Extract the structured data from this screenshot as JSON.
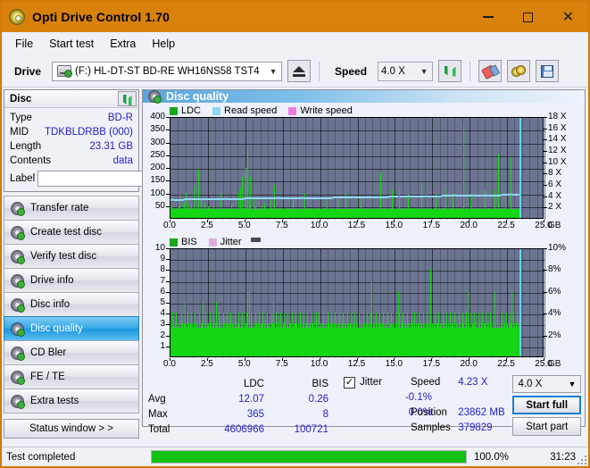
{
  "window": {
    "title": "Opti Drive Control 1.70",
    "icon": "disc-icon",
    "minimize": "—",
    "maximize": "□",
    "close": "✕"
  },
  "menu": [
    "File",
    "Start test",
    "Extra",
    "Help"
  ],
  "toolbar": {
    "drive_label": "Drive",
    "drive_value": "(F:)  HL-DT-ST BD-RE  WH16NS58 TST4",
    "eject_icon": "eject-icon",
    "speed_label": "Speed",
    "speed_value": "4.0 X",
    "refresh_icon": "refresh-icon",
    "erase_icon": "erase-icon",
    "discs_icon": "discs-icon",
    "save_icon": "save-icon"
  },
  "disc_panel": {
    "title": "Disc",
    "refresh_icon": "refresh-icon",
    "rows": [
      {
        "key": "Type",
        "value": "BD-R"
      },
      {
        "key": "MID",
        "value": "TDKBLDRBB (000)"
      },
      {
        "key": "Length",
        "value": "23.31 GB"
      },
      {
        "key": "Contents",
        "value": "data"
      }
    ],
    "label_key": "Label",
    "label_value": "",
    "label_button_icon": "cd-icon"
  },
  "nav": {
    "items": [
      {
        "label": "Transfer rate",
        "icon": "disc-transfer-icon",
        "active": false
      },
      {
        "label": "Create test disc",
        "icon": "disc-create-icon",
        "active": false
      },
      {
        "label": "Verify test disc",
        "icon": "disc-verify-icon",
        "active": false
      },
      {
        "label": "Drive info",
        "icon": "disc-drive-icon",
        "active": false
      },
      {
        "label": "Disc info",
        "icon": "disc-info-icon",
        "active": false
      },
      {
        "label": "Disc quality",
        "icon": "disc-quality-icon",
        "active": true
      },
      {
        "label": "CD Bler",
        "icon": "disc-bler-icon",
        "active": false
      },
      {
        "label": "FE / TE",
        "icon": "disc-fete-icon",
        "active": false
      },
      {
        "label": "Extra tests",
        "icon": "disc-extra-icon",
        "active": false
      }
    ],
    "status_window": "Status window > >"
  },
  "content": {
    "title": "Disc quality",
    "title_icon": "disc-quality-icon"
  },
  "chart_data": [
    {
      "type": "bar",
      "name": "ldc-chart",
      "title": "",
      "legend": [
        {
          "label": "LDC",
          "color": "#1aa81a"
        },
        {
          "label": "Read speed",
          "color": "#8fd8f5"
        },
        {
          "label": "Write speed",
          "color": "#f07ae0"
        }
      ],
      "xlabel": "GB",
      "xlim": [
        0,
        25.0
      ],
      "xticks": [
        "0.0",
        "2.5",
        "5.0",
        "7.5",
        "10.0",
        "12.5",
        "15.0",
        "17.5",
        "20.0",
        "22.5",
        "25.0"
      ],
      "ylabel_left": "LDC",
      "ylim": [
        0,
        400
      ],
      "yticks": [
        50,
        100,
        150,
        200,
        250,
        300,
        350,
        400
      ],
      "ylabel_right": "Speed",
      "ylim_right": [
        0,
        18
      ],
      "yticks_right": [
        "2 X",
        "4 X",
        "6 X",
        "8 X",
        "10 X",
        "12 X",
        "14 X",
        "16 X",
        "18 X"
      ],
      "grid": true,
      "data_end_gb": 23.31,
      "baseline": 35,
      "values": [
        48,
        42,
        38,
        36,
        34,
        33,
        40,
        36,
        33,
        34,
        36,
        44,
        33,
        92,
        36,
        34,
        35,
        38,
        33,
        60,
        34,
        33,
        100,
        35,
        34,
        33,
        48,
        36,
        33,
        34,
        55,
        33,
        37,
        120,
        34,
        33,
        36,
        42,
        33,
        35,
        190,
        33,
        36,
        34,
        70,
        33,
        35,
        33,
        38,
        60,
        33,
        34,
        36,
        33,
        45,
        33,
        34,
        38,
        33,
        36,
        34,
        33,
        55,
        33,
        34,
        36,
        33,
        38,
        33,
        34,
        33,
        36,
        100,
        33,
        34,
        33,
        38,
        34,
        33,
        36,
        33,
        34,
        40,
        33,
        36,
        33,
        34,
        52,
        33,
        36,
        34,
        33,
        38,
        33,
        35,
        33,
        34,
        100,
        33,
        36,
        120,
        33,
        35,
        160,
        33,
        38,
        33,
        195,
        34,
        36,
        280,
        34,
        33,
        45,
        160,
        33,
        36,
        34,
        33,
        80,
        34,
        33,
        45,
        33,
        36,
        34,
        33,
        38,
        33,
        34,
        44,
        33,
        36,
        33,
        34,
        60,
        33,
        38,
        34,
        33,
        36,
        33,
        34,
        75,
        33,
        36,
        34,
        33,
        130,
        34,
        33,
        36,
        33,
        38,
        33,
        34,
        36,
        33,
        34,
        33,
        38,
        33,
        36,
        34,
        33,
        40,
        33,
        36,
        33,
        34,
        38,
        33,
        36,
        34,
        33,
        70,
        33,
        36,
        33,
        34,
        38,
        33,
        36,
        33,
        34,
        36,
        33,
        38,
        34,
        33,
        36,
        33,
        100,
        34,
        33,
        36,
        33,
        38,
        33,
        34,
        36,
        33,
        38,
        33,
        36,
        34,
        33,
        36,
        33,
        38,
        33,
        34,
        36,
        33,
        38,
        33,
        36,
        34,
        33,
        38,
        33,
        36,
        33,
        34,
        80,
        33,
        36,
        33,
        34,
        38,
        33,
        36,
        34,
        33,
        38,
        33,
        36,
        33,
        34,
        72,
        33,
        36,
        34,
        33,
        38,
        33,
        36,
        33,
        34,
        36,
        33,
        105,
        34,
        33,
        38,
        33,
        36,
        33,
        34,
        38,
        33,
        36,
        34,
        33,
        38,
        33,
        36,
        33,
        34,
        38,
        33,
        36,
        33,
        80,
        38,
        33,
        36,
        34,
        33,
        38,
        33,
        36,
        33,
        34,
        38,
        33,
        36,
        34,
        33,
        36,
        33,
        38,
        33,
        34,
        36,
        33,
        38,
        33,
        36,
        34,
        33,
        180,
        33,
        36,
        34,
        33,
        38,
        33,
        36,
        33,
        34,
        36,
        33,
        38,
        34,
        33,
        36,
        33,
        110,
        33,
        36,
        34,
        33,
        38,
        33,
        36,
        33,
        34,
        120,
        33,
        36,
        34,
        33,
        38,
        33,
        36,
        33,
        34,
        38,
        33,
        90,
        34,
        33,
        36,
        33,
        38,
        33,
        34,
        36,
        33,
        38,
        33,
        36,
        34,
        33,
        38,
        33,
        36,
        33,
        34,
        140,
        33,
        36,
        34,
        33,
        38,
        33,
        36,
        33,
        34,
        36,
        33,
        38,
        34,
        33,
        36,
        33,
        38,
        33,
        34,
        95,
        33,
        36,
        33,
        34,
        38,
        33,
        36,
        34,
        33,
        38,
        33,
        36,
        33,
        120,
        38,
        33,
        36,
        33,
        34,
        38,
        33,
        36,
        34,
        33,
        95,
        33,
        36,
        33,
        34,
        38,
        33,
        36,
        34,
        33,
        38,
        33,
        36,
        33,
        34,
        365,
        33,
        36,
        34,
        33,
        38,
        33,
        36,
        33,
        34,
        90,
        33,
        36,
        34,
        33,
        38,
        33,
        36,
        33,
        34,
        38,
        33,
        36,
        33,
        34,
        38,
        33,
        36,
        34,
        33,
        110,
        33,
        36,
        33,
        34,
        38,
        33,
        36,
        34,
        33,
        38,
        33,
        36,
        33,
        34,
        110,
        33,
        36,
        33,
        34,
        250,
        33,
        36,
        34,
        33,
        38,
        33,
        36,
        33,
        34,
        85,
        33,
        36,
        34,
        33,
        38,
        33,
        240,
        33,
        34,
        36,
        33,
        38,
        34,
        33,
        36,
        33,
        38,
        33,
        34
      ],
      "read_speed": [
        3.6,
        3.7,
        3.7,
        3.7,
        3.8,
        3.8,
        3.8,
        3.8,
        3.8,
        3.8,
        3.8,
        3.8,
        3.8,
        3.8,
        3.8,
        3.8,
        3.85,
        3.85,
        3.85,
        3.85,
        3.85,
        3.9,
        3.9,
        3.9,
        3.9,
        3.9,
        3.9,
        3.9,
        3.9,
        3.9,
        3.9,
        3.95,
        3.95,
        3.95,
        3.95,
        3.95,
        3.95,
        3.95,
        4.0,
        4.0,
        4.0,
        4.0,
        4.0,
        4.0,
        4.0,
        4.0,
        4.05,
        4.05,
        4.05,
        4.05,
        4.05,
        4.05,
        4.1,
        4.1,
        4.1,
        4.1,
        4.1,
        4.15,
        4.15,
        4.15,
        4.15,
        4.15,
        4.2,
        4.2,
        4.2,
        4.2,
        4.2,
        4.2,
        4.25,
        4.25,
        4.25,
        4.25,
        4.25,
        4.3,
        4.3,
        4.3,
        4.3,
        4.35,
        4.35,
        4.35,
        4.35,
        4.4,
        4.4,
        4.4,
        4.4,
        4.4,
        4.45,
        4.45,
        4.45,
        4.5,
        4.5,
        4.5,
        4.5,
        4.5,
        4.55,
        4.55,
        4.55,
        4.6,
        4.6,
        4.6
      ]
    },
    {
      "type": "bar",
      "name": "bis-chart",
      "title": "",
      "legend": [
        {
          "label": "BIS",
          "color": "#1aa81a"
        },
        {
          "label": "Jitter",
          "color": "#e0aee0"
        }
      ],
      "xlabel": "GB",
      "xlim": [
        0,
        25.0
      ],
      "xticks": [
        "0.0",
        "2.5",
        "5.0",
        "7.5",
        "10.0",
        "12.5",
        "15.0",
        "17.5",
        "20.0",
        "22.5",
        "25.0"
      ],
      "ylabel_left": "BIS",
      "ylim": [
        0,
        10
      ],
      "yticks": [
        1,
        2,
        3,
        4,
        5,
        6,
        7,
        8,
        9,
        10
      ],
      "ylabel_right": "Jitter",
      "ylim_right": [
        0,
        10
      ],
      "yticks_right": [
        "2%",
        "4%",
        "6%",
        "8%",
        "10%"
      ],
      "grid": true,
      "data_end_gb": 23.31,
      "baseline": 2.6,
      "values": [
        3,
        2,
        4,
        2,
        3,
        2,
        3,
        2,
        4,
        2,
        3,
        2,
        2,
        3,
        2,
        4,
        2,
        3,
        2,
        3,
        5,
        2,
        3,
        2,
        4,
        2,
        3,
        2,
        3,
        4,
        2,
        3,
        2,
        3,
        2,
        4,
        2,
        3,
        2,
        3,
        2,
        4,
        2,
        3,
        2,
        3,
        5,
        2,
        3,
        2,
        4,
        2,
        3,
        2,
        3,
        2,
        4,
        2,
        3,
        2,
        3,
        2,
        4,
        2,
        3,
        5,
        2,
        3,
        2,
        4,
        2,
        3,
        2,
        3,
        2,
        4,
        2,
        3,
        2,
        3,
        4,
        2,
        3,
        2,
        3,
        2,
        4,
        2,
        3,
        2,
        3,
        2,
        4,
        2,
        3,
        2,
        3,
        4,
        2,
        3,
        2,
        3,
        2,
        4,
        2,
        3,
        2,
        3,
        2,
        4,
        6,
        2,
        3,
        6,
        2,
        4,
        2,
        3,
        2,
        3,
        2,
        4,
        2,
        3,
        2,
        3,
        2,
        4,
        2,
        3,
        2,
        3,
        4,
        2,
        3,
        2,
        3,
        2,
        4,
        2,
        3,
        2,
        3,
        2,
        4,
        2,
        3,
        5,
        2,
        3,
        2,
        4,
        2,
        3,
        2,
        3,
        2,
        4,
        2,
        3,
        2,
        3,
        4,
        2,
        3,
        2,
        3,
        2,
        4,
        2,
        3,
        2,
        3,
        2,
        4,
        2,
        3,
        2,
        3,
        4,
        2,
        3,
        2,
        3,
        2,
        4,
        2,
        3,
        2,
        3,
        2,
        4,
        2,
        3,
        2,
        3,
        4,
        2,
        3,
        2,
        3,
        2,
        4,
        2,
        3,
        2,
        3,
        2,
        4,
        2,
        3,
        2,
        3,
        4,
        2,
        3,
        2,
        3,
        2,
        4,
        2,
        3,
        2,
        3,
        2,
        4,
        2,
        3,
        2,
        3,
        4,
        2,
        3,
        2,
        3,
        2,
        4,
        2,
        3,
        2,
        3,
        2,
        4,
        2,
        3,
        2,
        3,
        4,
        2,
        3,
        2,
        3,
        2,
        4,
        2,
        3,
        2,
        3,
        2,
        4,
        2,
        3,
        2,
        3,
        4,
        2,
        3,
        2,
        3,
        2,
        4,
        2,
        3,
        2,
        3,
        2,
        4,
        2,
        3,
        2,
        3,
        4,
        2,
        3,
        2,
        3,
        2,
        4,
        7,
        2,
        3,
        2,
        3,
        2,
        4,
        2,
        3,
        2,
        3,
        4,
        2,
        3,
        2,
        3,
        2,
        4,
        2,
        3,
        2,
        3,
        2,
        4,
        2,
        3,
        2,
        3,
        4,
        2,
        3,
        2,
        3,
        2,
        4,
        2,
        3,
        2,
        6,
        2,
        4,
        2,
        3,
        2,
        3,
        4,
        2,
        3,
        2,
        3,
        2,
        4,
        2,
        3,
        2,
        3,
        2,
        4,
        2,
        3,
        2,
        3,
        4,
        2,
        3,
        2,
        3,
        2,
        4,
        2,
        3,
        2,
        3,
        2,
        4,
        2,
        3,
        2,
        3,
        4,
        2,
        3,
        2,
        3,
        2,
        8,
        2,
        3,
        2,
        3,
        2,
        4,
        2,
        3,
        2,
        3,
        4,
        2,
        3,
        2,
        3,
        2,
        4,
        2,
        3,
        2,
        3,
        2,
        4,
        2,
        3,
        2,
        3,
        4,
        2,
        3,
        2,
        3,
        2,
        4,
        2,
        3,
        2,
        3,
        2,
        4,
        2,
        3,
        2,
        3,
        4,
        2,
        3,
        2,
        3,
        2,
        4,
        2,
        3,
        2,
        6,
        2,
        4,
        2,
        3,
        2,
        3,
        4,
        2,
        3,
        2,
        3,
        2,
        4,
        2,
        3,
        2,
        3,
        2,
        4,
        2,
        3,
        2,
        3,
        4,
        2,
        3,
        2,
        3,
        2,
        4,
        2,
        3,
        2,
        3,
        2,
        6,
        2,
        3,
        2,
        3,
        4,
        2,
        3,
        2,
        3,
        2,
        4,
        2,
        3,
        2,
        3,
        2,
        4,
        2,
        3,
        2,
        3,
        4,
        2,
        3,
        6,
        2,
        4,
        2,
        3,
        2,
        3,
        2,
        4,
        2,
        3
      ]
    }
  ],
  "stats": {
    "col_headers": [
      "LDC",
      "BIS"
    ],
    "rows": [
      {
        "key": "Avg",
        "ldc": "12.07",
        "bis": "0.26",
        "jitter": "-0.1%"
      },
      {
        "key": "Max",
        "ldc": "365",
        "bis": "8",
        "jitter": "0.0%"
      },
      {
        "key": "Total",
        "ldc": "4606966",
        "bis": "100721",
        "jitter": ""
      }
    ],
    "jitter_label": "Jitter",
    "jitter_checked": true,
    "jitter_check_glyph": "✓",
    "right": [
      {
        "key": "Speed",
        "value": "4.23 X"
      },
      {
        "key": "Position",
        "value": "23862 MB"
      },
      {
        "key": "Samples",
        "value": "379829"
      }
    ],
    "speed_select": "4.0 X",
    "start_full": "Start full",
    "start_part": "Start part"
  },
  "statusbar": {
    "text": "Test completed",
    "progress": 100,
    "percent": "100.0%",
    "time": "31:23"
  }
}
